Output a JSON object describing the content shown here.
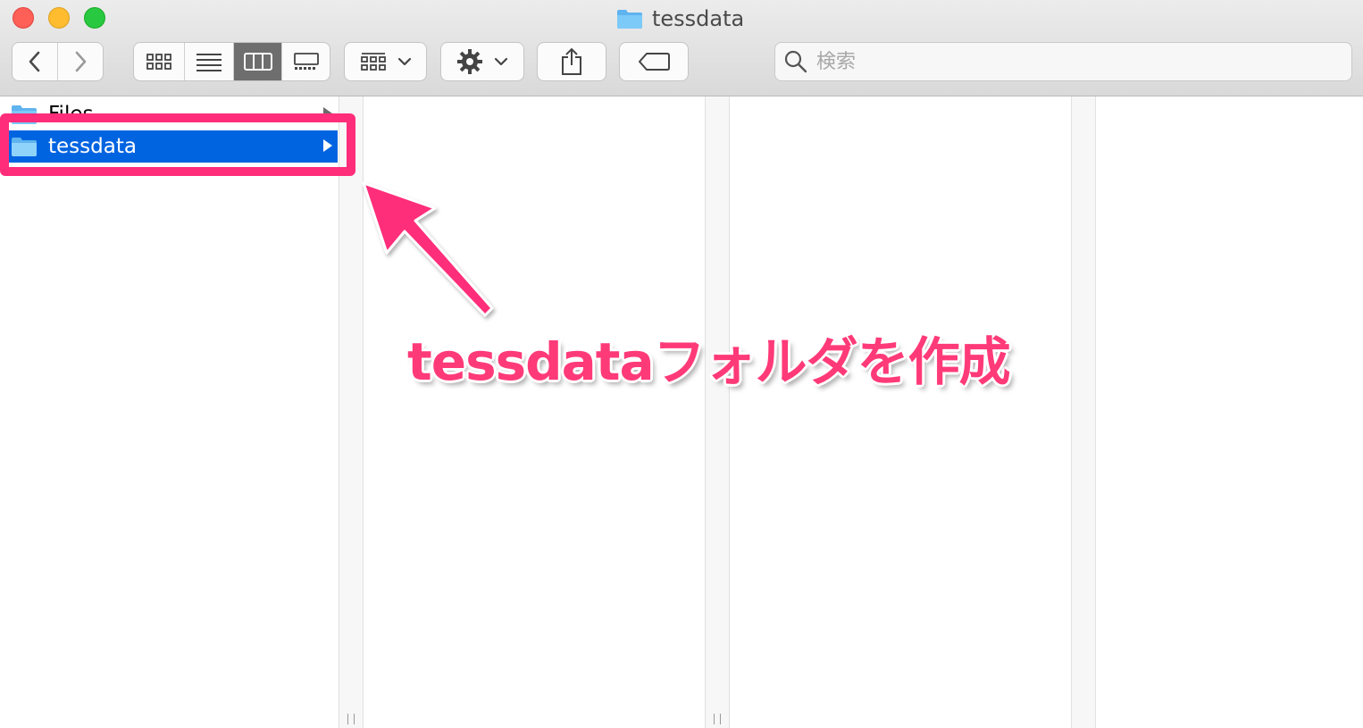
{
  "window": {
    "title": "tessdata"
  },
  "toolbar": {
    "nav": [
      "chevron-left-icon",
      "chevron-right-icon"
    ],
    "view_modes": [
      "icon-view-icon",
      "list-view-icon",
      "column-view-icon",
      "gallery-view-icon"
    ],
    "active_view": "column-view",
    "group_icon": "group-grid-icon",
    "action_icon": "gear-icon",
    "share_icon": "share-icon",
    "tag_icon": "tag-icon",
    "search": {
      "placeholder": "検索",
      "value": ""
    }
  },
  "sidebar": {
    "items": [
      {
        "label": "Files",
        "selected": false
      },
      {
        "label": "tessdata",
        "selected": true
      }
    ]
  },
  "annotation": {
    "text": "tessdataフォルダを作成"
  },
  "colors": {
    "selection": "#0064e1",
    "annotation_pink": "#ff2d7a",
    "folder_blue": "#6cc0f5"
  }
}
